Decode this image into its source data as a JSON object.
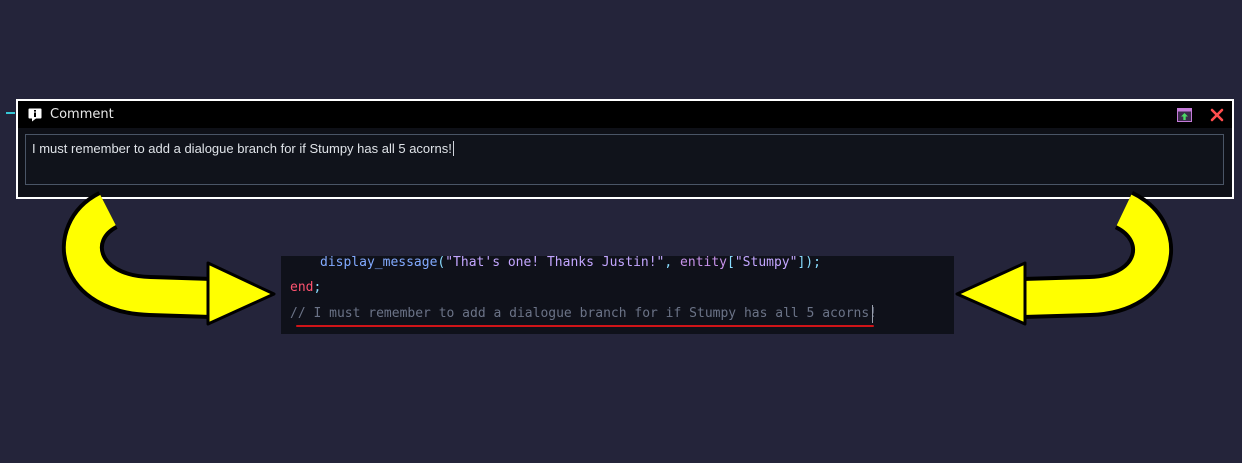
{
  "comment_window": {
    "title": "Comment",
    "text": "I must remember to add a dialogue branch for if Stumpy has all 5 acorns!",
    "icons": [
      "info-icon",
      "extract-icon",
      "close-icon"
    ]
  },
  "code": {
    "line1": {
      "fn": "display_message",
      "open": "(",
      "str1": "\"That's one! Thanks Justin!\"",
      "comma": ", ",
      "var": "entity",
      "lb": "[",
      "str2": "\"Stumpy\"",
      "close": "]);"
    },
    "line2": {
      "kw": "end",
      "semi": ";"
    },
    "line3": {
      "comment": "// I must remember to add a dialogue branch for if Stumpy has all 5 acorns!"
    }
  },
  "colors": {
    "background": "#24243a",
    "arrow": "#ffff00",
    "underline": "#d01418",
    "close": "#ff4d4d",
    "wire": "#35c7d6"
  }
}
